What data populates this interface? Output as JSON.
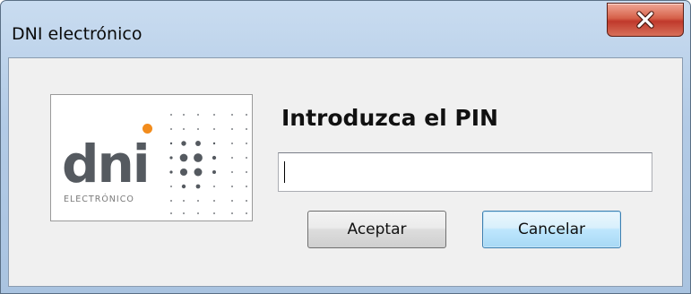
{
  "window": {
    "title": "DNI electrónico"
  },
  "logo": {
    "word": "dni",
    "subtitle": "ELECTRÓNICO",
    "accent_color": "#f28c1d",
    "text_color": "#555a60"
  },
  "dialog": {
    "prompt": "Introduzca el PIN",
    "pin_value": "",
    "accept_label": "Aceptar",
    "cancel_label": "Cancelar"
  },
  "icons": {
    "close": "close-icon"
  }
}
